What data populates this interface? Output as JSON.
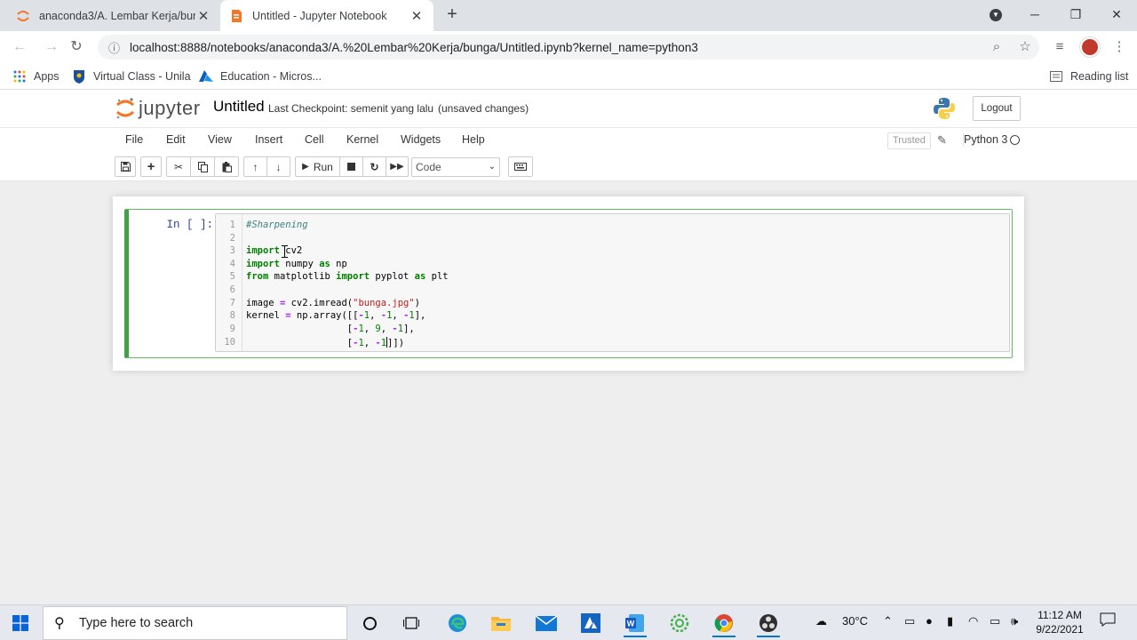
{
  "browser": {
    "tabs": [
      {
        "title": "anaconda3/A. Lembar Kerja/bung",
        "active": false
      },
      {
        "title": "Untitled - Jupyter Notebook",
        "active": true
      }
    ],
    "url": "localhost:8888/notebooks/anaconda3/A.%20Lembar%20Kerja/bunga/Untitled.ipynb?kernel_name=python3",
    "bookmarks": [
      {
        "label": "Apps",
        "icon": "apps-grid-icon"
      },
      {
        "label": "Virtual Class - Unila",
        "icon": "unila-shield-icon"
      },
      {
        "label": "Education - Micros...",
        "icon": "azure-icon"
      }
    ],
    "reading_list": "Reading list"
  },
  "jupyter": {
    "logo_text": "jupyter",
    "notebook_name": "Untitled",
    "checkpoint": "Last Checkpoint: semenit yang lalu",
    "autosave": "(unsaved changes)",
    "logout": "Logout",
    "menus": [
      "File",
      "Edit",
      "View",
      "Insert",
      "Cell",
      "Kernel",
      "Widgets",
      "Help"
    ],
    "trusted": "Trusted",
    "kernel_name": "Python 3",
    "run_label": "Run",
    "cell_type": "Code"
  },
  "cell": {
    "prompt": "In [ ]:",
    "line_numbers": [
      "1",
      "2",
      "3",
      "4",
      "5",
      "6",
      "7",
      "8",
      "9",
      "10"
    ]
  },
  "taskbar": {
    "search_placeholder": "Type here to search",
    "temperature": "30°C",
    "time": "11:12 AM",
    "date": "9/22/2021"
  }
}
